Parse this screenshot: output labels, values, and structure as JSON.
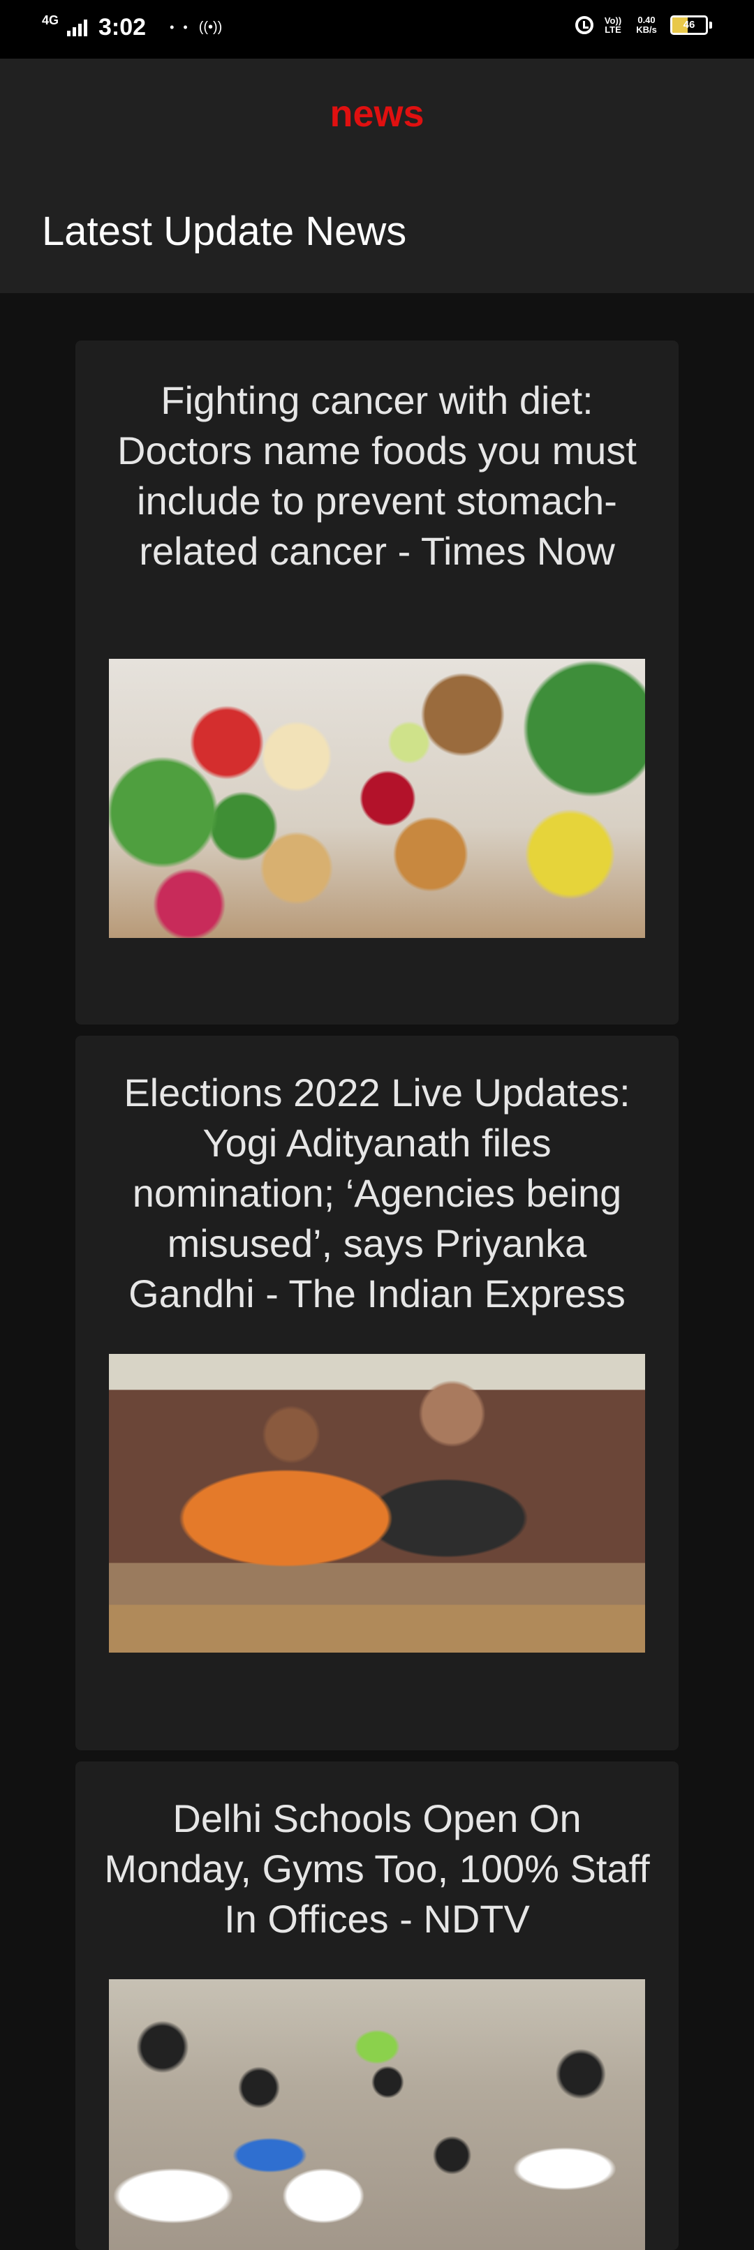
{
  "status_bar": {
    "network": "4G",
    "time": "3:02",
    "dots": "• •",
    "volte": "Vo)) LTE",
    "speed": "0.40 KB/s",
    "battery_level": 46,
    "battery_text": "46"
  },
  "header": {
    "app_title": "news",
    "title_color": "#e01010",
    "section_title": "Latest Update News"
  },
  "articles": [
    {
      "headline": "Fighting cancer with diet: Doctors name foods you must include to prevent stomach-related cancer - Times Now",
      "image": "fruits-vegetables-nuts-photo"
    },
    {
      "headline": "Elections 2022 Live Updates: Yogi Adityanath files nomination; ‘Agencies being misused’, says Priyanka Gandhi - The Indian Express",
      "image": "nomination-filing-photo"
    },
    {
      "headline": "Delhi Schools Open On Monday, Gyms Too, 100% Staff In Offices - NDTV",
      "image": "students-in-masks-photo"
    }
  ],
  "icons": {
    "signal": "signal-bars-icon",
    "hotspot": "hotspot-icon",
    "alarm": "alarm-icon",
    "battery": "battery-icon"
  }
}
